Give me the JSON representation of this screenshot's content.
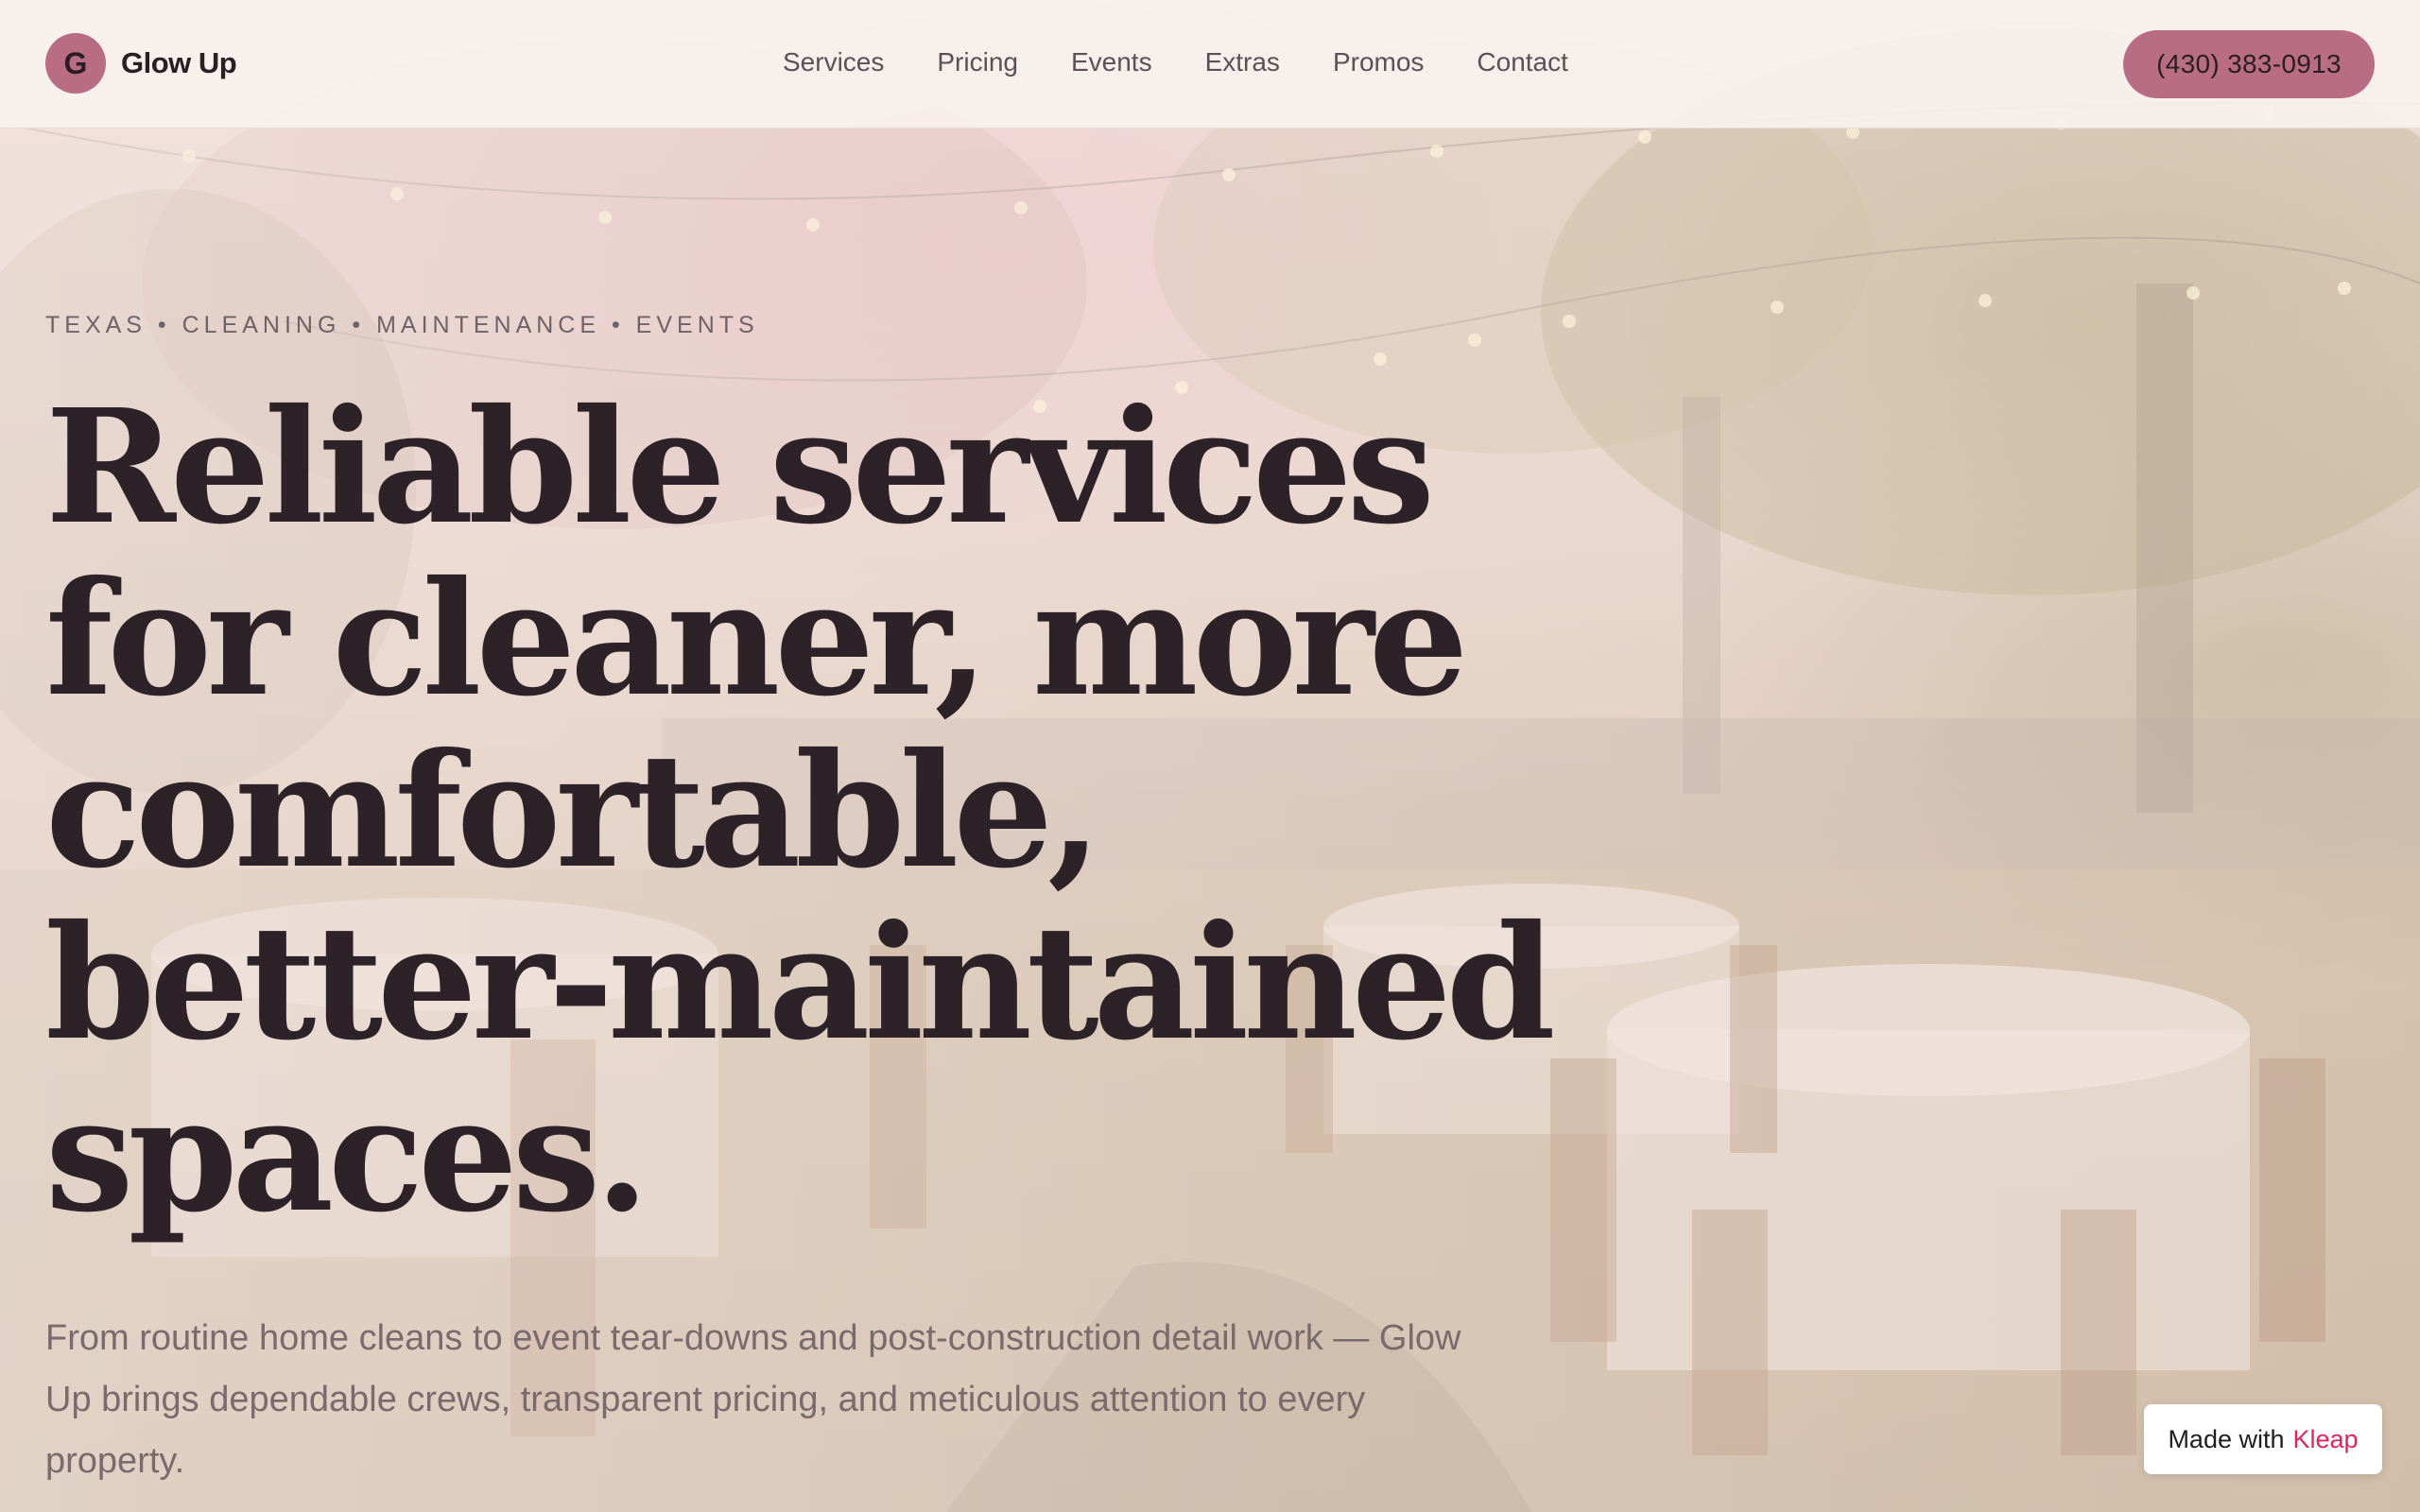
{
  "brand": {
    "mark": "G",
    "name": "Glow Up"
  },
  "nav": {
    "items": [
      {
        "label": "Services"
      },
      {
        "label": "Pricing"
      },
      {
        "label": "Events"
      },
      {
        "label": "Extras"
      },
      {
        "label": "Promos"
      },
      {
        "label": "Contact"
      }
    ]
  },
  "header": {
    "phone_label": "(430) 383-0913"
  },
  "hero": {
    "eyebrow": "TEXAS • CLEANING • MAINTENANCE • EVENTS",
    "headline_lines": [
      "Reliable services",
      "for cleaner, more",
      "comfortable,",
      "better-maintained",
      "spaces."
    ],
    "lede": "From routine home cleans to event tear-downs and post-construction detail work — Glow Up brings dependable crews, transparent pricing, and meticulous attention to every property."
  },
  "badge": {
    "prefix": "Made with",
    "brand": "Kleap"
  },
  "colors": {
    "accent": "#b86d84",
    "text_dark": "#2c2228",
    "badge_brand": "#e0245e"
  }
}
